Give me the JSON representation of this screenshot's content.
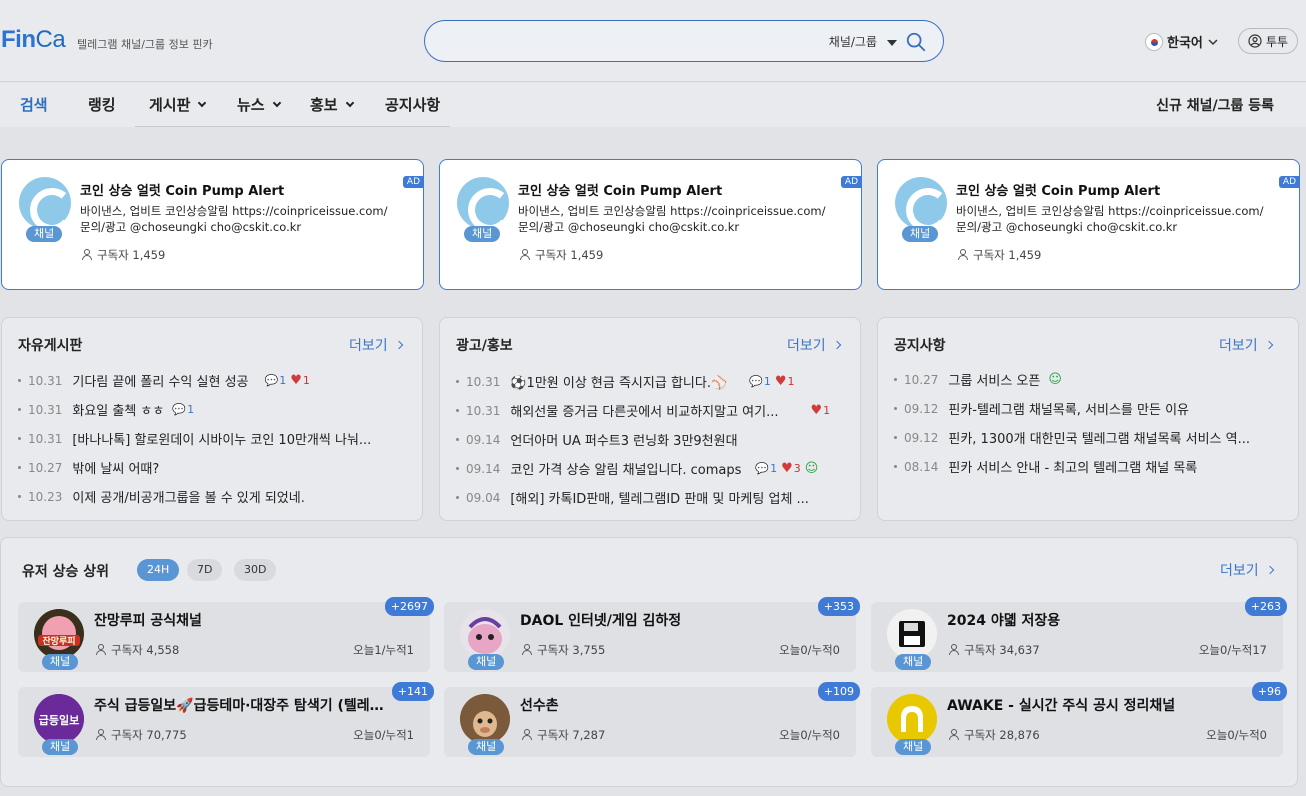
{
  "header": {
    "logo_fin": "Fin",
    "logo_ca": "Ca",
    "tagline": "텔레그램 채널/그룹 정보 핀카",
    "search_placeholder": "",
    "search_filter": "채널/그룹",
    "language": "한국어",
    "user": "투투"
  },
  "nav": {
    "items": [
      "검색",
      "랭킹",
      "게시판",
      "뉴스",
      "홍보",
      "공지사항"
    ],
    "register": "신규 채널/그룹 등록"
  },
  "ads": [
    {
      "title": "코인 상승 얼럿 Coin Pump Alert",
      "desc": "바이낸스, 업비트 코인상승알림 https://coinpriceissue.com/ 문의/광고 @choseungki cho@cskit.co.kr",
      "subs": "구독자 1,459",
      "chip": "채널",
      "badge": "AD"
    },
    {
      "title": "코인 상승 얼럿 Coin Pump Alert",
      "desc": "바이낸스, 업비트 코인상승알림 https://coinpriceissue.com/ 문의/광고 @choseungki cho@cskit.co.kr",
      "subs": "구독자 1,459",
      "chip": "채널",
      "badge": "AD"
    },
    {
      "title": "코인 상승 얼럿 Coin Pump Alert",
      "desc": "바이낸스, 업비트 코인상승알림 https://coinpriceissue.com/ 문의/광고 @choseungki cho@cskit.co.kr",
      "subs": "구독자 1,459",
      "chip": "채널",
      "badge": "AD"
    }
  ],
  "more_label": "더보기",
  "boards": [
    {
      "title": "자유게시판",
      "posts": [
        {
          "date": "10.31",
          "text": "기다림 끝에 폴리 수익 실현 성공",
          "comments": "1",
          "likes": "1"
        },
        {
          "date": "10.31",
          "text": "화요일 출첵 ㅎㅎ",
          "comments": "1",
          "likes": ""
        },
        {
          "date": "10.31",
          "text": "[바나나톡] 할로윈데이 시바이누 코인 10만개씩 나눠...",
          "comments": "",
          "likes": ""
        },
        {
          "date": "10.27",
          "text": "밖에 날씨 어때?",
          "comments": "",
          "likes": ""
        },
        {
          "date": "10.23",
          "text": "이제 공개/비공개그룹을 볼 수 있게 되었네.",
          "comments": "",
          "likes": ""
        }
      ]
    },
    {
      "title": "광고/홍보",
      "posts": [
        {
          "date": "10.31",
          "text": "⚽1만원 이상 현금 즉시지급 합니다.⚾",
          "comments": "1",
          "likes": "1"
        },
        {
          "date": "10.31",
          "text": "해외선물 증거금 다른곳에서 비교하지말고 여기...",
          "comments": "",
          "likes": "1"
        },
        {
          "date": "09.14",
          "text": "언더아머 UA 퍼수트3 런닝화 3만9천원대",
          "comments": "",
          "likes": ""
        },
        {
          "date": "09.14",
          "text": "코인 가격 상승 알림 채널입니다. comaps",
          "comments": "1",
          "likes": "3"
        },
        {
          "date": "09.04",
          "text": "[해외] 카톡ID판매, 텔레그램ID 판매 및 마케팅 업체 ...",
          "comments": "",
          "likes": ""
        }
      ]
    },
    {
      "title": "공지사항",
      "posts": [
        {
          "date": "10.27",
          "text": "그룹 서비스 오픈",
          "comments": "",
          "likes": ""
        },
        {
          "date": "09.12",
          "text": "핀카-텔레그램 채널목록, 서비스를 만든 이유",
          "comments": "",
          "likes": ""
        },
        {
          "date": "09.12",
          "text": "핀카, 1300개 대한민국 텔레그램 채널목록 서비스 역...",
          "comments": "",
          "likes": ""
        },
        {
          "date": "08.14",
          "text": "핀카 서비스 안내 - 최고의 텔레그램 채널 목록",
          "comments": "",
          "likes": ""
        }
      ]
    }
  ],
  "ranking": {
    "title": "유저 상승 상위",
    "periods": [
      "24H",
      "7D",
      "30D"
    ],
    "items": [
      {
        "name": "잔망루피 공식채널",
        "subs": "구독자 4,558",
        "today": "오늘1/누적1",
        "badge": "+2697",
        "chip": "채널",
        "avatar_color": "#5a4a2a",
        "avatar_text": "잔망루피"
      },
      {
        "name": "DAOL 인터넷/게임 김하정",
        "subs": "구독자 3,755",
        "today": "오늘0/누적0",
        "badge": "+353",
        "chip": "채널",
        "avatar_color": "#d9b6d6",
        "avatar_text": ""
      },
      {
        "name": "2024 야뎳 저장용",
        "subs": "구독자 34,637",
        "today": "오늘0/누적17",
        "badge": "+263",
        "chip": "채널",
        "avatar_color": "#f3f3f3",
        "avatar_text": ""
      },
      {
        "name": "주식 급등일보🚀급등테마·대장주 탐색기 (텔레그...",
        "subs": "구독자 70,775",
        "today": "오늘0/누적1",
        "badge": "+141",
        "chip": "채널",
        "avatar_color": "#5a2a8a",
        "avatar_text": "급등일보"
      },
      {
        "name": "선수촌",
        "subs": "구독자 7,287",
        "today": "오늘0/누적0",
        "badge": "+109",
        "chip": "채널",
        "avatar_color": "#8a6a4a",
        "avatar_text": ""
      },
      {
        "name": "AWAKE - 실시간 주식 공시 정리채널",
        "subs": "구독자 28,876",
        "today": "오늘0/누적0",
        "badge": "+96",
        "chip": "채널",
        "avatar_color": "#e8c800",
        "avatar_text": ""
      }
    ]
  },
  "colors": {
    "accent": "#3f7bd6",
    "heart": "#d23b3b",
    "green": "#2aa34a"
  }
}
